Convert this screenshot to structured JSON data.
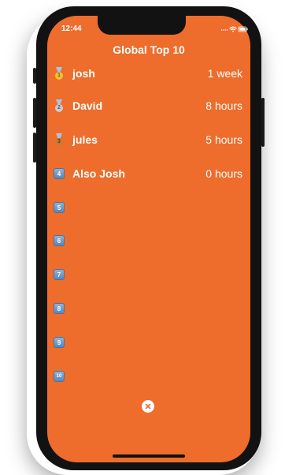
{
  "status_bar": {
    "time": "12:44"
  },
  "title": "Global Top 10",
  "leaderboard": [
    {
      "rank_icon": "gold-medal-icon",
      "rank": "1",
      "name": "josh",
      "value": "1 week",
      "medal_color": "#f2c230"
    },
    {
      "rank_icon": "silver-medal-icon",
      "rank": "2",
      "name": "David",
      "value": "8 hours",
      "medal_color": "#c8ccd2"
    },
    {
      "rank_icon": "bronze-medal-icon",
      "rank": "3",
      "name": "jules",
      "value": "5 hours",
      "medal_color": "#c77b38"
    },
    {
      "rank_icon": "keycap-4-icon",
      "rank": "4",
      "name": "Also Josh",
      "value": "0 hours"
    },
    {
      "rank_icon": "keycap-5-icon",
      "rank": "5",
      "name": "",
      "value": ""
    },
    {
      "rank_icon": "keycap-6-icon",
      "rank": "6",
      "name": "",
      "value": ""
    },
    {
      "rank_icon": "keycap-7-icon",
      "rank": "7",
      "name": "",
      "value": ""
    },
    {
      "rank_icon": "keycap-8-icon",
      "rank": "8",
      "name": "",
      "value": ""
    },
    {
      "rank_icon": "keycap-9-icon",
      "rank": "9",
      "name": "",
      "value": ""
    },
    {
      "rank_icon": "keycap-10-icon",
      "rank": "10",
      "name": "",
      "value": ""
    }
  ],
  "colors": {
    "background": "#ee6c2c",
    "text": "#ffffff"
  },
  "close_icon": "close-icon"
}
